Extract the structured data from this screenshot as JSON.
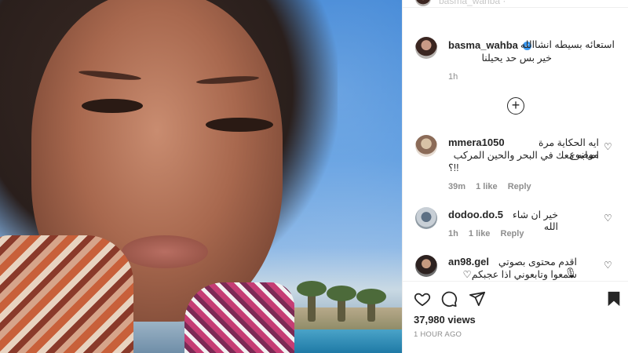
{
  "top": {
    "faded_username": "basma_wahba ·"
  },
  "caption": {
    "username": "basma_wahba",
    "verified_mark": "✓",
    "line1": "استعائه بسيطه انشاالله",
    "line2": "خير بس حد يحيلنا",
    "time": "1h"
  },
  "load_more_symbol": "+",
  "comments": [
    {
      "username": "mmera1050",
      "text_line1": "ايه الحكاية مرة موضوع",
      "text_line2": "اصابه معك في البحر والحين المركب",
      "text_line3": "!!؟",
      "time": "39m",
      "likes": "1 like",
      "reply": "Reply"
    },
    {
      "username": "dodoo.do.5",
      "text_line1": "خير ان شاء الله",
      "time": "1h",
      "likes": "1 like",
      "reply": "Reply"
    },
    {
      "username": "an98.gel",
      "text_line1": "اقدم محتوى بصوتي 🎙",
      "text_line2": "سمعوا وتابعوني اذا عجبكم♡"
    }
  ],
  "actions": {
    "like_icon": "heart-outline",
    "comment_icon": "speech-bubble",
    "share_icon": "paper-plane",
    "save_icon": "bookmark-filled"
  },
  "stats": {
    "views": "37,980 views",
    "posted": "1 HOUR AGO"
  },
  "colors": {
    "verified": "#3897f0",
    "meta_gray": "#8e8e8e",
    "text": "#262626"
  }
}
